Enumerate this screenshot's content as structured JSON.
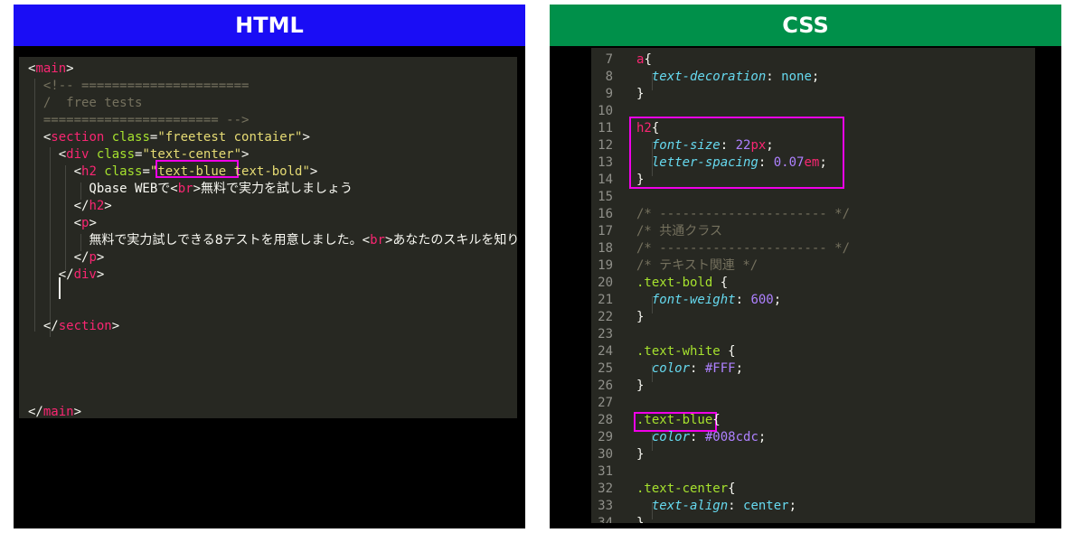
{
  "colors": {
    "html_header_bg": "#1a0df5",
    "css_header_bg": "#00904a",
    "editor_bg": "#272822",
    "highlight_box": "#f000e8"
  },
  "html_panel": {
    "title": "HTML",
    "lines": [
      [
        {
          "t": "<",
          "c": "punc"
        },
        {
          "t": "main",
          "c": "tag"
        },
        {
          "t": ">",
          "c": "punc"
        }
      ],
      [
        {
          "t": "  <!-- ======================",
          "c": "cmt"
        }
      ],
      [
        {
          "t": "  /  free tests",
          "c": "cmt"
        }
      ],
      [
        {
          "t": "  ======================= -->",
          "c": "cmt"
        }
      ],
      [
        {
          "t": "  <",
          "c": "punc"
        },
        {
          "t": "section",
          "c": "tag"
        },
        {
          "t": " class",
          "c": "attr"
        },
        {
          "t": "=",
          "c": "punc"
        },
        {
          "t": "\"freetest contaier\"",
          "c": "str"
        },
        {
          "t": ">",
          "c": "punc"
        }
      ],
      [
        {
          "t": "    <",
          "c": "punc"
        },
        {
          "t": "div",
          "c": "tag"
        },
        {
          "t": " class",
          "c": "attr"
        },
        {
          "t": "=",
          "c": "punc"
        },
        {
          "t": "\"text-center\"",
          "c": "str"
        },
        {
          "t": ">",
          "c": "punc"
        }
      ],
      [
        {
          "t": "      <",
          "c": "punc"
        },
        {
          "t": "h2",
          "c": "tag"
        },
        {
          "t": " class",
          "c": "attr"
        },
        {
          "t": "=",
          "c": "punc"
        },
        {
          "t": "\"text-blue text-bold\"",
          "c": "str"
        },
        {
          "t": ">",
          "c": "punc"
        }
      ],
      [
        {
          "t": "        Qbase WEB",
          "c": "punc"
        },
        {
          "t": "で",
          "c": "punc jp"
        },
        {
          "t": "<",
          "c": "punc"
        },
        {
          "t": "br",
          "c": "tag"
        },
        {
          "t": ">",
          "c": "punc"
        },
        {
          "t": "無料で実力を試しましょう",
          "c": "punc jp"
        }
      ],
      [
        {
          "t": "      </",
          "c": "punc"
        },
        {
          "t": "h2",
          "c": "tag"
        },
        {
          "t": ">",
          "c": "punc"
        }
      ],
      [
        {
          "t": "      <",
          "c": "punc"
        },
        {
          "t": "p",
          "c": "tag"
        },
        {
          "t": ">",
          "c": "punc"
        }
      ],
      [
        {
          "t": "        ",
          "c": "punc"
        },
        {
          "t": "無料で実力試しできる8テストを用意しました。",
          "c": "punc jp"
        },
        {
          "t": "<",
          "c": "punc"
        },
        {
          "t": "br",
          "c": "tag"
        },
        {
          "t": ">",
          "c": "punc"
        },
        {
          "t": "あなたのスキルを知りまし",
          "c": "punc jp"
        }
      ],
      [
        {
          "t": "      </",
          "c": "punc"
        },
        {
          "t": "p",
          "c": "tag"
        },
        {
          "t": ">",
          "c": "punc"
        }
      ],
      [
        {
          "t": "    </",
          "c": "punc"
        },
        {
          "t": "div",
          "c": "tag"
        },
        {
          "t": ">",
          "c": "punc"
        }
      ],
      [],
      [],
      [
        {
          "t": "  </",
          "c": "punc"
        },
        {
          "t": "section",
          "c": "tag"
        },
        {
          "t": ">",
          "c": "punc"
        }
      ],
      [],
      [],
      [],
      [],
      [
        {
          "t": "</",
          "c": "punc"
        },
        {
          "t": "main",
          "c": "tag"
        },
        {
          "t": ">",
          "c": "punc"
        }
      ]
    ]
  },
  "css_panel": {
    "title": "CSS",
    "lines": [
      {
        "n": "7",
        "s": [
          {
            "t": "a",
            "c": "tag"
          },
          {
            "t": "{",
            "c": "punc"
          }
        ]
      },
      {
        "n": "8",
        "s": [
          {
            "t": "  ",
            "c": "punc"
          },
          {
            "t": "text-decoration",
            "c": "prop"
          },
          {
            "t": ": ",
            "c": "punc"
          },
          {
            "t": "none",
            "c": "kw"
          },
          {
            "t": ";",
            "c": "punc"
          }
        ]
      },
      {
        "n": "9",
        "s": [
          {
            "t": "}",
            "c": "punc"
          }
        ]
      },
      {
        "n": "10",
        "s": []
      },
      {
        "n": "11",
        "s": [
          {
            "t": "h2",
            "c": "tag"
          },
          {
            "t": "{",
            "c": "punc"
          }
        ]
      },
      {
        "n": "12",
        "s": [
          {
            "t": "  ",
            "c": "punc"
          },
          {
            "t": "font-size",
            "c": "prop"
          },
          {
            "t": ": ",
            "c": "punc"
          },
          {
            "t": "22",
            "c": "num"
          },
          {
            "t": "px",
            "c": "unit"
          },
          {
            "t": ";",
            "c": "punc"
          }
        ]
      },
      {
        "n": "13",
        "s": [
          {
            "t": "  ",
            "c": "punc"
          },
          {
            "t": "letter-spacing",
            "c": "prop"
          },
          {
            "t": ": ",
            "c": "punc"
          },
          {
            "t": "0.07",
            "c": "num"
          },
          {
            "t": "em",
            "c": "unit"
          },
          {
            "t": ";",
            "c": "punc"
          }
        ]
      },
      {
        "n": "14",
        "s": [
          {
            "t": "}",
            "c": "punc"
          }
        ]
      },
      {
        "n": "15",
        "s": []
      },
      {
        "n": "16",
        "s": [
          {
            "t": "/* ---------------------- */",
            "c": "cmt"
          }
        ]
      },
      {
        "n": "17",
        "s": [
          {
            "t": "/* ",
            "c": "cmt"
          },
          {
            "t": "共通クラス",
            "c": "cmt jp"
          }
        ]
      },
      {
        "n": "18",
        "s": [
          {
            "t": "/* ---------------------- */",
            "c": "cmt"
          }
        ]
      },
      {
        "n": "19",
        "s": [
          {
            "t": "/* ",
            "c": "cmt"
          },
          {
            "t": "テキスト関連",
            "c": "cmt jp"
          },
          {
            "t": " */",
            "c": "cmt"
          }
        ]
      },
      {
        "n": "20",
        "s": [
          {
            "t": ".text-bold",
            "c": "sel"
          },
          {
            "t": " {",
            "c": "punc"
          }
        ]
      },
      {
        "n": "21",
        "s": [
          {
            "t": "  ",
            "c": "punc"
          },
          {
            "t": "font-weight",
            "c": "prop"
          },
          {
            "t": ": ",
            "c": "punc"
          },
          {
            "t": "600",
            "c": "num"
          },
          {
            "t": ";",
            "c": "punc"
          }
        ]
      },
      {
        "n": "22",
        "s": [
          {
            "t": "}",
            "c": "punc"
          }
        ]
      },
      {
        "n": "23",
        "s": []
      },
      {
        "n": "24",
        "s": [
          {
            "t": ".text-white",
            "c": "sel"
          },
          {
            "t": " {",
            "c": "punc"
          }
        ]
      },
      {
        "n": "25",
        "s": [
          {
            "t": "  ",
            "c": "punc"
          },
          {
            "t": "color",
            "c": "prop"
          },
          {
            "t": ": ",
            "c": "punc"
          },
          {
            "t": "#FFF",
            "c": "num"
          },
          {
            "t": ";",
            "c": "punc"
          }
        ]
      },
      {
        "n": "26",
        "s": [
          {
            "t": "}",
            "c": "punc"
          }
        ]
      },
      {
        "n": "27",
        "s": []
      },
      {
        "n": "28",
        "s": [
          {
            "t": ".text-blue",
            "c": "sel"
          },
          {
            "t": "{",
            "c": "punc"
          }
        ]
      },
      {
        "n": "29",
        "s": [
          {
            "t": "  ",
            "c": "punc"
          },
          {
            "t": "color",
            "c": "prop"
          },
          {
            "t": ": ",
            "c": "punc"
          },
          {
            "t": "#008cdc",
            "c": "num"
          },
          {
            "t": ";",
            "c": "punc"
          }
        ]
      },
      {
        "n": "30",
        "s": [
          {
            "t": "}",
            "c": "punc"
          }
        ]
      },
      {
        "n": "31",
        "s": []
      },
      {
        "n": "32",
        "s": [
          {
            "t": ".text-center",
            "c": "sel"
          },
          {
            "t": "{",
            "c": "punc"
          }
        ]
      },
      {
        "n": "33",
        "s": [
          {
            "t": "  ",
            "c": "punc"
          },
          {
            "t": "text-align",
            "c": "prop"
          },
          {
            "t": ": ",
            "c": "punc"
          },
          {
            "t": "center",
            "c": "kw"
          },
          {
            "t": ";",
            "c": "punc"
          }
        ]
      },
      {
        "n": "34",
        "s": [
          {
            "t": "}",
            "c": "punc"
          }
        ]
      }
    ]
  }
}
